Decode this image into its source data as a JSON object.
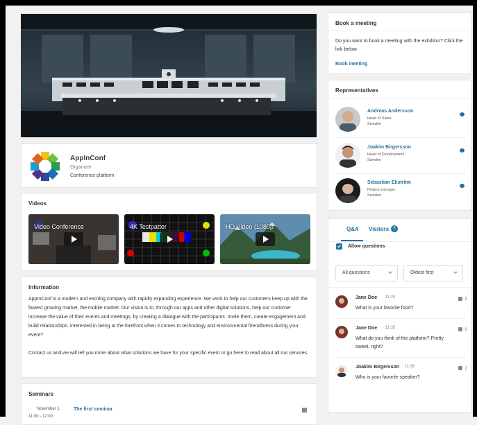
{
  "organizer": {
    "name": "AppInConf",
    "role": "Organizer",
    "description": "Conference platform"
  },
  "videos": {
    "title": "Videos",
    "items": [
      {
        "title": "Video Conference"
      },
      {
        "title": "4K Testpatter"
      },
      {
        "title": "HD Video (1080p"
      }
    ]
  },
  "information": {
    "title": "Information",
    "paragraph1": "AppInConf is a modern and exciting company with rapidly expanding experience. We work to help our customers keep up with the fastest growing market, the mobile market. Our vision is to, through our apps and other digital solutions, help our customer increase the value of their events and meetings, by creating a dialogue with the participants. Invite them, create engagement and build relationships. Interested in being at the forefront when it comes to technology and environmental friendliness during your event?",
    "paragraph2": "Contact us and we will tell you more about what solutions we have for your specific event or go here to read about all our services."
  },
  "seminars": {
    "title": "Seminars",
    "items": [
      {
        "date": "November 1",
        "time": "11:00 - 12:00",
        "title": "The first seminar"
      }
    ]
  },
  "book_meeting": {
    "title": "Book a meeting",
    "text": "Do you want to book a meeting with the exhibitor? Click the link below.",
    "link": "Book meeting"
  },
  "representatives": {
    "title": "Representatives",
    "items": [
      {
        "name": "Andreas Andersson",
        "role": "Head of Sales",
        "country": "Sweden"
      },
      {
        "name": "Joakim Birgersson",
        "role": "Head of Development",
        "country": "Sweden"
      },
      {
        "name": "Sebastian Ekström",
        "role": "Project manager",
        "country": "Sweden"
      }
    ]
  },
  "qa": {
    "tab_qa": "Q&A",
    "tab_visitors": "Visitors",
    "visitors_count": "5",
    "allow_questions": "Allow questions",
    "filter_select": "All questions",
    "sort_select": "Oldest first",
    "questions": [
      {
        "author": "Jane Doe",
        "time": "· 11:30",
        "text": "What is your favorite food?",
        "likes": "0"
      },
      {
        "author": "Jane Doe",
        "time": "· 11:35",
        "text": "What do you think of the platform? Pretty sweet, right?",
        "likes": "0"
      },
      {
        "author": "Joakim Birgersson",
        "time": "· 11:36",
        "text": "Who is your favorite speaker?",
        "likes": "2"
      }
    ]
  },
  "colors": {
    "accent": "#2a6f9b",
    "background": "#f1f1f1"
  }
}
